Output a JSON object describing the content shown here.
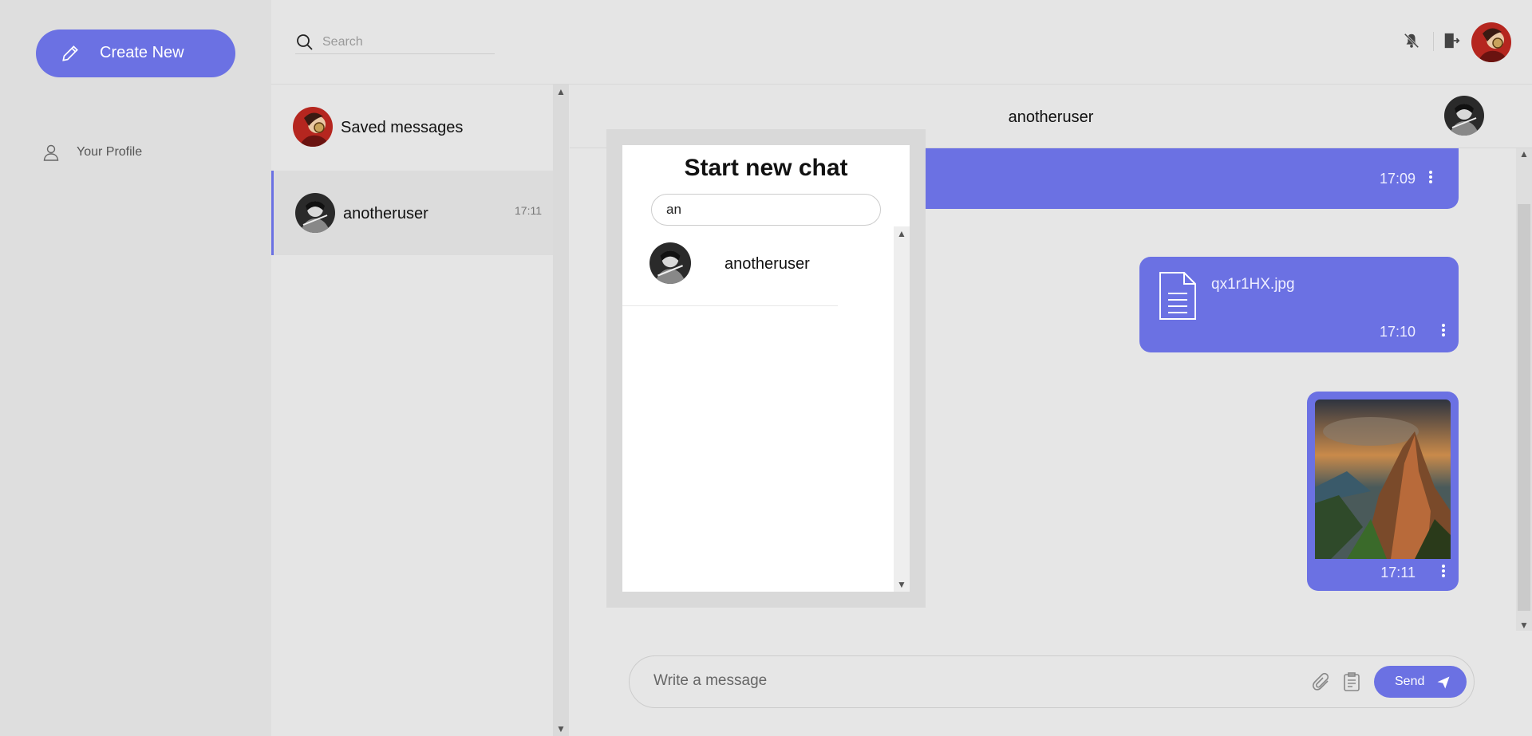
{
  "sidebar": {
    "create_label": "Create New",
    "profile_label": "Your Profile"
  },
  "topbar": {
    "search_placeholder": "Search"
  },
  "chatlist": {
    "items": [
      {
        "name": "Saved messages",
        "time": ""
      },
      {
        "name": "anotheruser",
        "time": "17:11"
      }
    ]
  },
  "chat": {
    "title": "anotheruser",
    "messages": [
      {
        "type": "text",
        "time": "17:09"
      },
      {
        "type": "file",
        "filename": "qx1r1HX.jpg",
        "time": "17:10"
      },
      {
        "type": "image",
        "time": "17:11"
      }
    ],
    "composer_placeholder": "Write a message",
    "send_label": "Send"
  },
  "modal": {
    "title": "Start new chat",
    "search_value": "an",
    "results": [
      {
        "name": "anotheruser"
      }
    ]
  },
  "colors": {
    "accent": "#6b71e3",
    "background": "#e6e6e6",
    "sidebar": "#dedede"
  }
}
